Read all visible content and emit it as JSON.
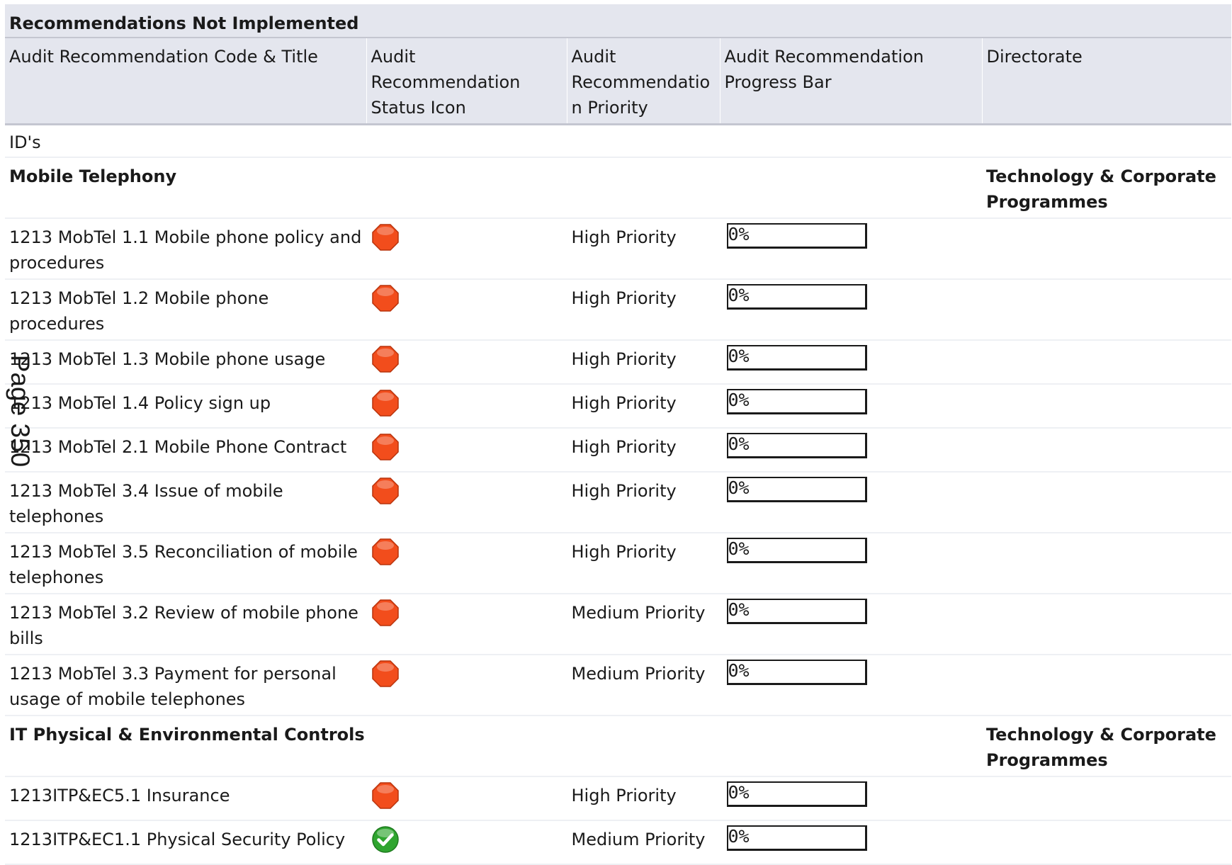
{
  "report": {
    "title": "Recommendations Not Implemented",
    "columns": [
      "Audit Recommendation Code & Title",
      "Audit Recommendation Status Icon",
      "Audit Recommendation Priority",
      "Audit Recommendation Progress Bar",
      "Directorate"
    ],
    "ids_label": "ID's",
    "groups": [
      {
        "name": "Mobile Telephony",
        "directorate": "Technology & Corporate Programmes",
        "rows": [
          {
            "code_title": "1213 MobTel 1.1 Mobile phone policy and procedures",
            "status": "not-implemented",
            "status_icon": "red-octagon-icon",
            "priority": "High Priority",
            "progress_percent": 0,
            "progress_label": "0%"
          },
          {
            "code_title": "1213 MobTel 1.2 Mobile phone procedures",
            "status": "not-implemented",
            "status_icon": "red-octagon-icon",
            "priority": "High Priority",
            "progress_percent": 0,
            "progress_label": "0%"
          },
          {
            "code_title": "1213 MobTel 1.3 Mobile phone usage",
            "status": "not-implemented",
            "status_icon": "red-octagon-icon",
            "priority": "High Priority",
            "progress_percent": 0,
            "progress_label": "0%"
          },
          {
            "code_title": "1213 MobTel 1.4 Policy sign up",
            "status": "not-implemented",
            "status_icon": "red-octagon-icon",
            "priority": "High Priority",
            "progress_percent": 0,
            "progress_label": "0%"
          },
          {
            "code_title": "1213 MobTel 2.1 Mobile Phone Contract",
            "status": "not-implemented",
            "status_icon": "red-octagon-icon",
            "priority": "High Priority",
            "progress_percent": 0,
            "progress_label": "0%"
          },
          {
            "code_title": "1213 MobTel 3.4 Issue of mobile telephones",
            "status": "not-implemented",
            "status_icon": "red-octagon-icon",
            "priority": "High Priority",
            "progress_percent": 0,
            "progress_label": "0%"
          },
          {
            "code_title": "1213 MobTel 3.5 Reconciliation of mobile telephones",
            "status": "not-implemented",
            "status_icon": "red-octagon-icon",
            "priority": "High Priority",
            "progress_percent": 0,
            "progress_label": "0%"
          },
          {
            "code_title": "1213 MobTel 3.2 Review of mobile phone bills",
            "status": "not-implemented",
            "status_icon": "red-octagon-icon",
            "priority": "Medium Priority",
            "progress_percent": 0,
            "progress_label": "0%"
          },
          {
            "code_title": "1213 MobTel 3.3 Payment for personal usage of mobile telephones",
            "status": "not-implemented",
            "status_icon": "red-octagon-icon",
            "priority": "Medium Priority",
            "progress_percent": 0,
            "progress_label": "0%"
          }
        ]
      },
      {
        "name": "IT Physical & Environmental Controls",
        "directorate": "Technology & Corporate Programmes",
        "rows": [
          {
            "code_title": "1213ITP&EC5.1 Insurance",
            "status": "not-implemented",
            "status_icon": "red-octagon-icon",
            "priority": "High Priority",
            "progress_percent": 0,
            "progress_label": "0%"
          },
          {
            "code_title": "1213ITP&EC1.1 Physical Security Policy",
            "status": "implemented",
            "status_icon": "green-check-icon",
            "priority": "Medium Priority",
            "progress_percent": 0,
            "progress_label": "0%"
          }
        ]
      }
    ]
  },
  "page_stamp": "Page 350",
  "colors": {
    "header_bg": "#e4e6ee",
    "header_border": "#c4c6d0",
    "row_divider": "#eef0f4",
    "status_red": "#f24d1c",
    "status_green": "#2fa52f",
    "text": "#1a1a1a"
  }
}
